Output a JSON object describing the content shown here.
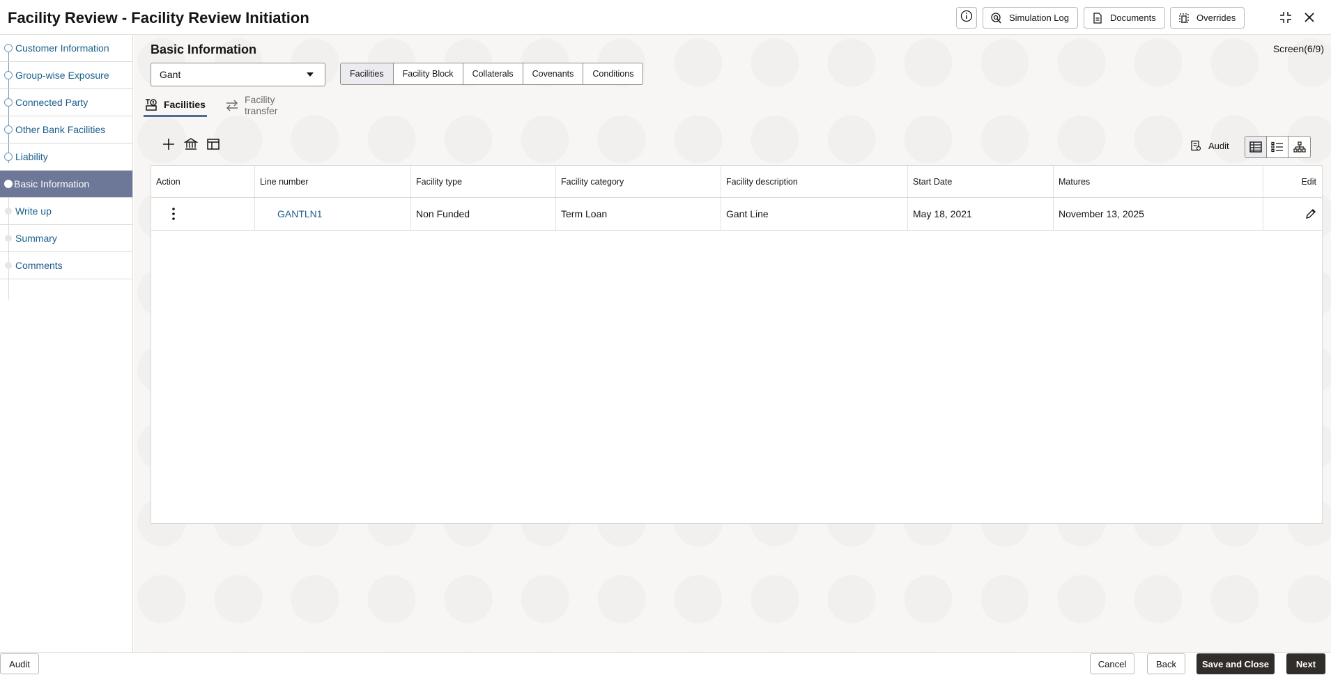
{
  "header": {
    "title": "Facility Review - Facility Review Initiation",
    "buttons": {
      "simulation_log": "Simulation Log",
      "documents": "Documents",
      "overrides": "Overrides"
    }
  },
  "sidebar": {
    "items": [
      {
        "label": "Customer Information",
        "state": "completed"
      },
      {
        "label": "Group-wise Exposure",
        "state": "completed"
      },
      {
        "label": "Connected Party",
        "state": "completed"
      },
      {
        "label": "Other Bank Facilities",
        "state": "completed"
      },
      {
        "label": "Liability",
        "state": "completed"
      },
      {
        "label": "Basic Information",
        "state": "active"
      },
      {
        "label": "Write up",
        "state": "pending"
      },
      {
        "label": "Summary",
        "state": "pending"
      },
      {
        "label": "Comments",
        "state": "pending"
      }
    ]
  },
  "main": {
    "section_title": "Basic Information",
    "screen_indicator": "Screen(6/9)",
    "select": {
      "value": "Gant"
    },
    "segments": [
      {
        "label": "Facilities",
        "selected": true
      },
      {
        "label": "Facility Block",
        "selected": false
      },
      {
        "label": "Collaterals",
        "selected": false
      },
      {
        "label": "Covenants",
        "selected": false
      },
      {
        "label": "Conditions",
        "selected": false
      }
    ],
    "subtabs": {
      "facilities": "Facilities",
      "facility_transfer": "Facility transfer"
    },
    "toolbar": {
      "audit_label": "Audit"
    },
    "table": {
      "columns": [
        "Action",
        "Line number",
        "Facility type",
        "Facility category",
        "Facility description",
        "Start Date",
        "Matures",
        "Edit"
      ],
      "rows": [
        {
          "line_number": "GANTLN1",
          "facility_type": "Non Funded",
          "facility_category": "Term Loan",
          "facility_description": "Gant Line",
          "start_date": "May 18, 2021",
          "matures": "November 13, 2025"
        }
      ]
    }
  },
  "footer": {
    "audit": "Audit",
    "cancel": "Cancel",
    "back": "Back",
    "save_and_close": "Save and Close",
    "next": "Next"
  },
  "colors": {
    "active_nav": "#6d7797",
    "link": "#1a5e8a",
    "primary_button": "#312d2a"
  }
}
